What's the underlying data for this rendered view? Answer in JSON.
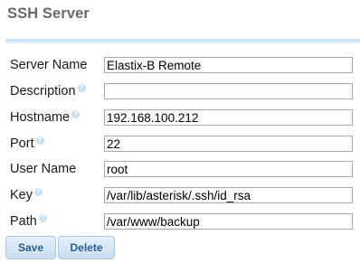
{
  "panel": {
    "title": "SSH Server"
  },
  "form": {
    "help_glyph": "?",
    "fields": [
      {
        "label": "Server Name",
        "value": "Elastix-B Remote",
        "help": false
      },
      {
        "label": "Description",
        "value": "",
        "help": true
      },
      {
        "label": "Hostname",
        "value": "192.168.100.212",
        "help": true
      },
      {
        "label": "Port",
        "value": "22",
        "help": true
      },
      {
        "label": "User Name",
        "value": "root",
        "help": false
      },
      {
        "label": "Key",
        "value": "/var/lib/asterisk/.ssh/id_rsa",
        "help": true
      },
      {
        "label": "Path",
        "value": "/var/www/backup",
        "help": true
      }
    ]
  },
  "actions": {
    "save_label": "Save",
    "delete_label": "Delete"
  },
  "colors": {
    "title": "#696969",
    "accent_bar": "#c2dcf0",
    "help_icon": "#c9dff0",
    "button_text": "#2b5f93"
  }
}
